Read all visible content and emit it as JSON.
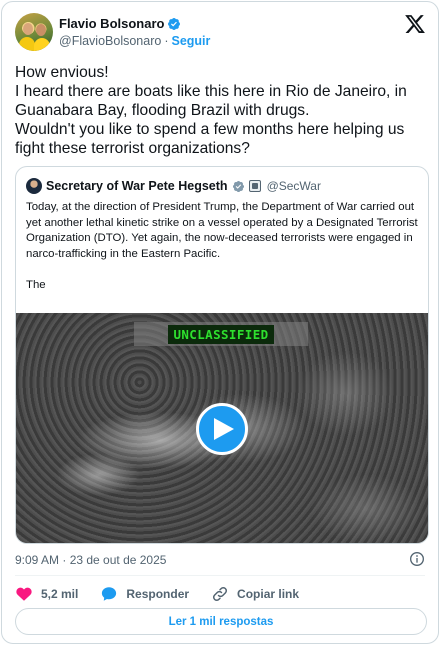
{
  "author": {
    "display_name": "Flavio Bolsonaro",
    "handle": "@FlavioBolsonaro",
    "separator": "·",
    "follow_label": "Seguir",
    "verified": true
  },
  "post": {
    "text": "How envious!\nI heard there are boats like this here in Rio de Janeiro, in Guanabara Bay, flooding Brazil with drugs.\nWouldn't you like to spend a few months here helping us fight these terrorist organizations?"
  },
  "quoted_post": {
    "display_name": "Secretary of War Pete Hegseth",
    "handle": "@SecWar",
    "text": "Today, at the direction of President Trump, the Department of War carried out yet another lethal kinetic strike on a vessel operated by a Designated Terrorist Organization (DTO). Yet again, the now-deceased terrorists were engaged in narco-trafficking in the Eastern Pacific.\n\nThe",
    "video": {
      "banner_text": "UNCLASSIFIED",
      "play_icon": "play-icon"
    }
  },
  "meta": {
    "timestamp": "9:09 AM · 23 de out de 2025"
  },
  "actions": {
    "likes_count": "5,2 mil",
    "reply_label": "Responder",
    "copy_link_label": "Copiar link"
  },
  "replies_button": {
    "label": "Ler 1 mil respostas"
  },
  "colors": {
    "accent": "#1d9bf0",
    "like": "#f91880",
    "text_secondary": "#536471",
    "border": "#cfd9de",
    "verified_gold": "#e2b719"
  }
}
